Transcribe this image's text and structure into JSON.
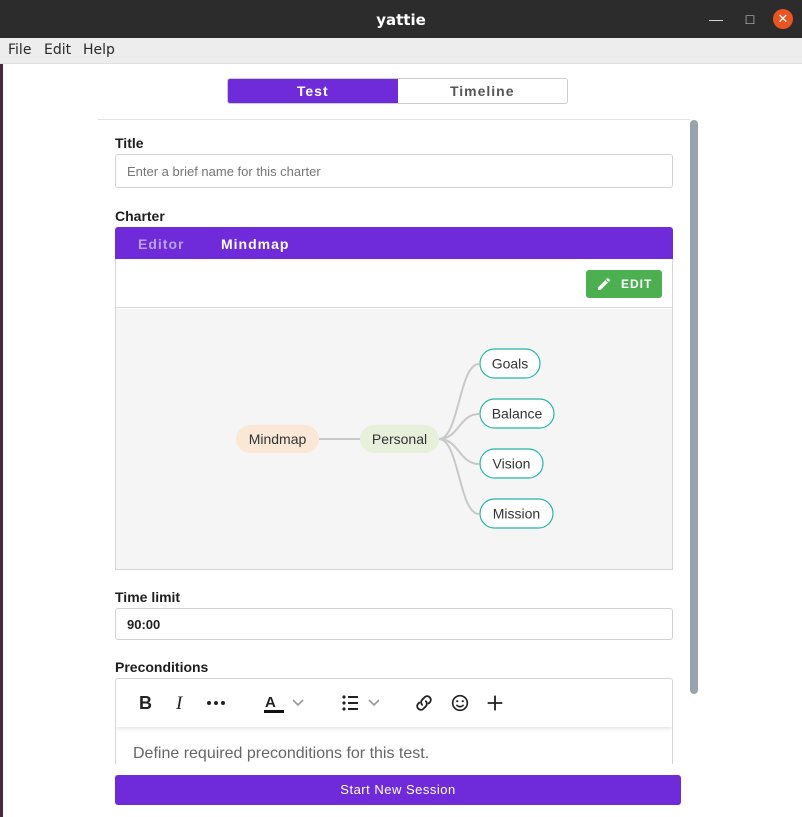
{
  "window": {
    "title": "yattie"
  },
  "menubar": [
    "File",
    "Edit",
    "Help"
  ],
  "top_tabs": [
    {
      "label": "Test",
      "active": true
    },
    {
      "label": "Timeline",
      "active": false
    }
  ],
  "form": {
    "title_label": "Title",
    "title_placeholder": "Enter a brief name for this charter",
    "charter_label": "Charter",
    "charter_tabs": [
      {
        "label": "Editor",
        "active": false
      },
      {
        "label": "Mindmap",
        "active": true
      }
    ],
    "edit_button": "EDIT",
    "mindmap": {
      "root": "Mindmap",
      "child": "Personal",
      "leaves": [
        "Goals",
        "Balance",
        "Vision",
        "Mission"
      ]
    },
    "time_limit_label": "Time limit",
    "time_limit_value": "90:00",
    "preconditions_label": "Preconditions",
    "preconditions_placeholder": "Define required preconditions for this test.",
    "start_button": "Start New Session"
  },
  "colors": {
    "accent": "#6f2bd9",
    "edit_green": "#4caf50",
    "root_node": "#fbe7d6",
    "child_node": "#e6f0da",
    "leaf_border": "#26b5a6"
  }
}
